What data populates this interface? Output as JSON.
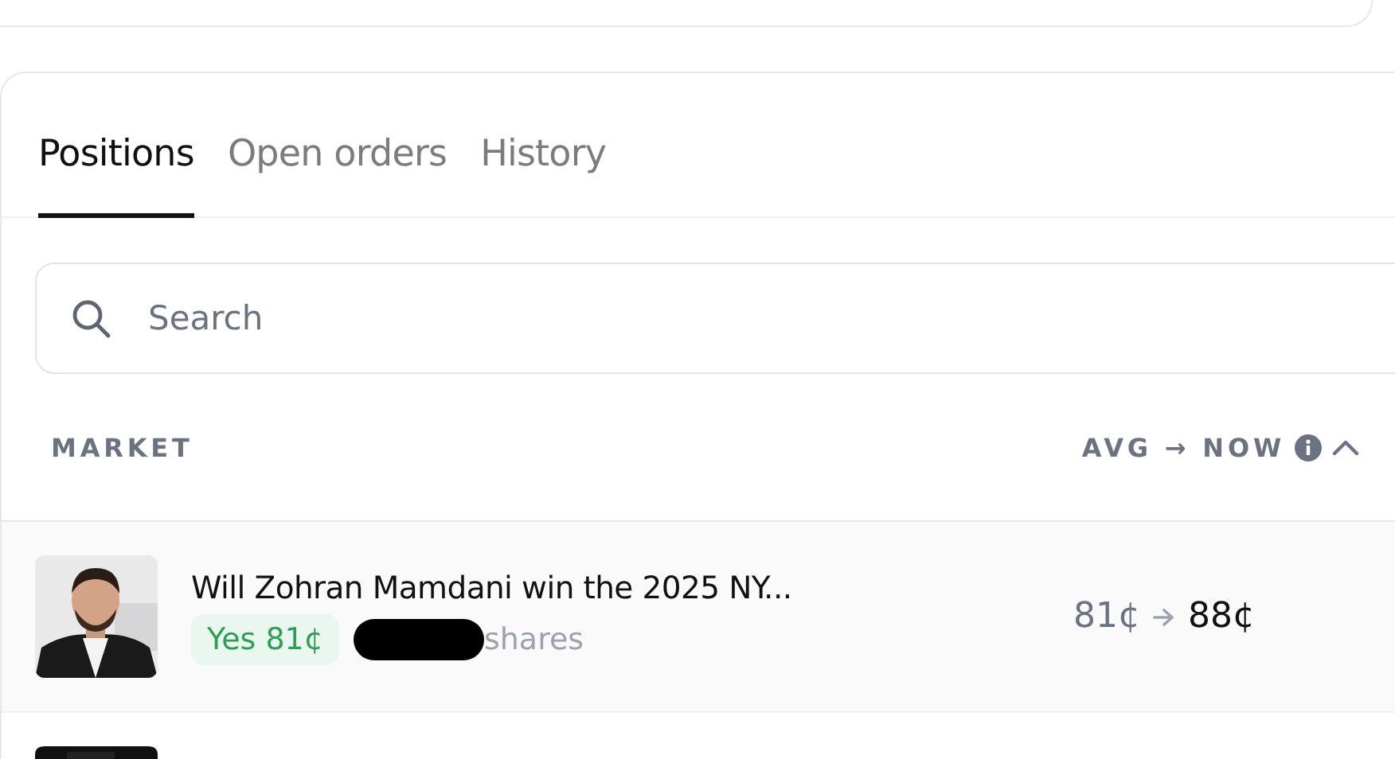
{
  "tabs": [
    {
      "label": "Positions",
      "selected": true
    },
    {
      "label": "Open orders",
      "selected": false
    },
    {
      "label": "History",
      "selected": false
    }
  ],
  "search": {
    "placeholder": "Search"
  },
  "table": {
    "columns": [
      {
        "label": "MARKET"
      },
      {
        "label": "AVG → NOW",
        "info": true,
        "sort_ascending": true
      }
    ],
    "rows": [
      {
        "kind": "position",
        "title": "Will Zohran Mamdani win the 2025 NY...",
        "outcome": "Yes 81¢",
        "shares_redacted": true,
        "shares_label": "shares",
        "avg": "81¢",
        "now": "88¢"
      },
      {
        "kind": "partial"
      }
    ]
  }
}
